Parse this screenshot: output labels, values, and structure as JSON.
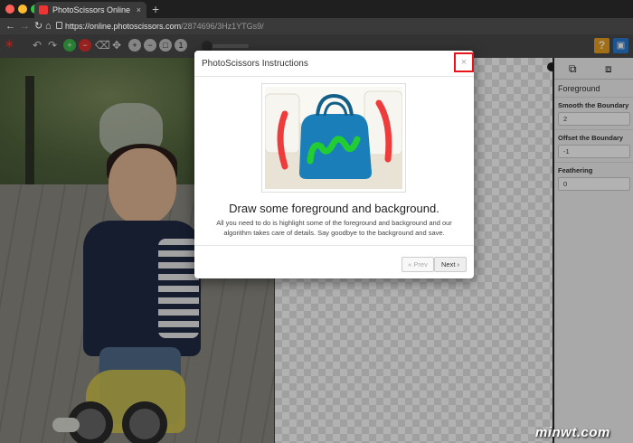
{
  "browser": {
    "tab_title": "PhotoScissors Online",
    "tab_close": "×",
    "new_tab": "+",
    "url_host": "https://online.photoscissors.com",
    "url_path": "/2874696/3Hz1YTGs9/"
  },
  "toolbar": {
    "help_label": "?",
    "colors": {
      "add": "#3bb54a",
      "remove": "#d9302c",
      "help": "#e8a020",
      "save": "#2a7ad0"
    }
  },
  "panel": {
    "heading": "Foreground",
    "fields": [
      {
        "label": "Smooth the Boundary",
        "value": "2"
      },
      {
        "label": "Offset the Boundary",
        "value": "-1"
      },
      {
        "label": "Feathering",
        "value": "0"
      }
    ]
  },
  "modal": {
    "title": "PhotoScissors Instructions",
    "close": "×",
    "heading": "Draw some foreground and background.",
    "text": "All you need to do is highlight some of the foreground and background and our algorithm takes care of details. Say goodbye to the background and save.",
    "prev_label": "« Prev",
    "next_label": "Next ›"
  },
  "watermark": "minwt.com"
}
